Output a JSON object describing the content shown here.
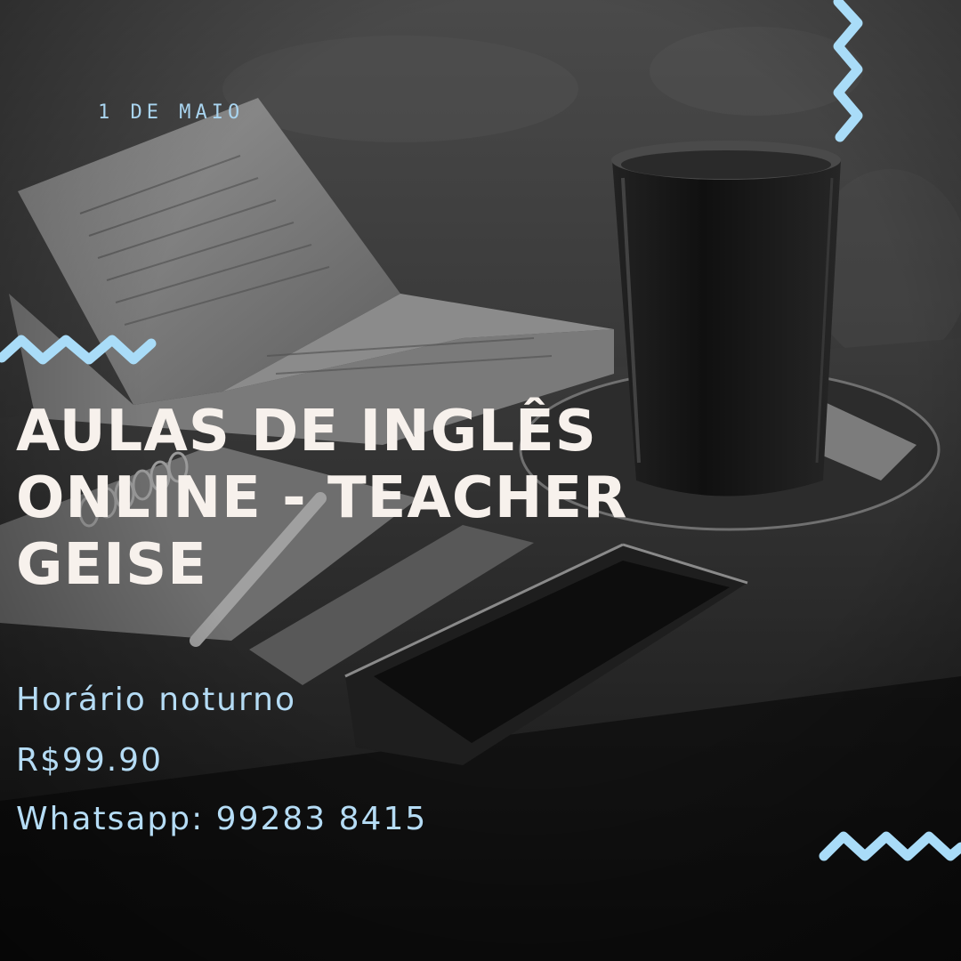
{
  "event": {
    "date": "1 DE MAIO"
  },
  "headline": {
    "line1": "AULAS DE INGLÊS",
    "line2": "ONLINE - TEACHER",
    "line3": "GEISE"
  },
  "details": {
    "schedule": "Horário noturno",
    "price": "R$99.90",
    "contact": "Whatsapp: 99283 8415"
  },
  "colors": {
    "accent": "#a9dcf8",
    "headline": "#f7f1ec",
    "info": "#b5dcf5"
  }
}
